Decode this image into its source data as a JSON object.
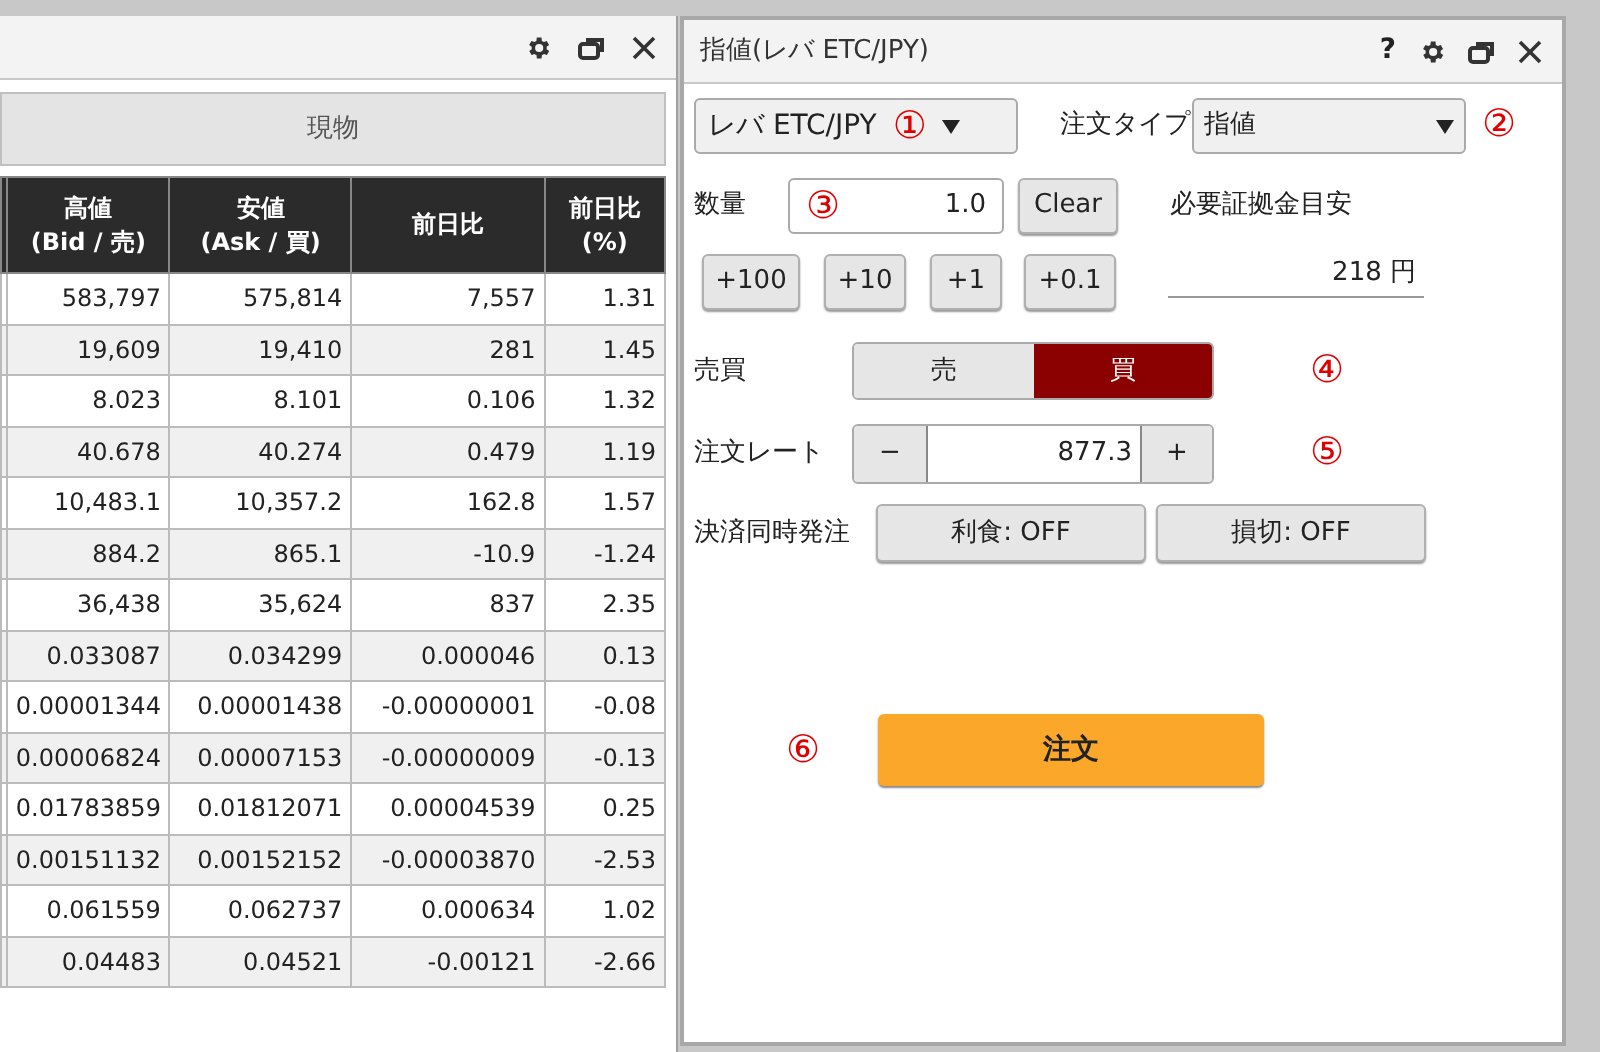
{
  "quote_panel": {
    "tab": "現物",
    "columns": [
      {
        "line1": "高値",
        "line2": "(Bid / 売)"
      },
      {
        "line1": "安値",
        "line2": "(Ask / 買)"
      },
      {
        "line1": "前日比"
      },
      {
        "line1": "前日比",
        "line2": "(%)"
      }
    ],
    "rows": [
      [
        "583,797",
        "575,814",
        "7,557",
        "1.31"
      ],
      [
        "19,609",
        "19,410",
        "281",
        "1.45"
      ],
      [
        "8.023",
        "8.101",
        "0.106",
        "1.32"
      ],
      [
        "40.678",
        "40.274",
        "0.479",
        "1.19"
      ],
      [
        "10,483.1",
        "10,357.2",
        "162.8",
        "1.57"
      ],
      [
        "884.2",
        "865.1",
        "-10.9",
        "-1.24"
      ],
      [
        "36,438",
        "35,624",
        "837",
        "2.35"
      ],
      [
        "0.033087",
        "0.034299",
        "0.000046",
        "0.13"
      ],
      [
        "0.00001344",
        "0.00001438",
        "-0.00000001",
        "-0.08"
      ],
      [
        "0.00006824",
        "0.00007153",
        "-0.00000009",
        "-0.13"
      ],
      [
        "0.01783859",
        "0.01812071",
        "0.00004539",
        "0.25"
      ],
      [
        "0.00151132",
        "0.00152152",
        "-0.00003870",
        "-2.53"
      ],
      [
        "0.061559",
        "0.062737",
        "0.000634",
        "1.02"
      ],
      [
        "0.04483",
        "0.04521",
        "-0.00121",
        "-2.66"
      ]
    ]
  },
  "order_panel": {
    "title": "指値(レバ ETC/JPY)",
    "help": "?",
    "symbol": {
      "value": "レバ ETC/JPY",
      "marker": "①"
    },
    "order_type": {
      "label": "注文タイプ",
      "value": "指値",
      "marker": "②"
    },
    "quantity": {
      "label": "数量",
      "value": "1.0",
      "marker": "③",
      "clear": "Clear"
    },
    "increments": [
      "+100",
      "+10",
      "+1",
      "+0.1"
    ],
    "margin": {
      "label": "必要証拠金目安",
      "value": "218 円"
    },
    "side": {
      "label": "売買",
      "options": [
        {
          "label": "売",
          "selected": false
        },
        {
          "label": "買",
          "selected": true
        }
      ],
      "marker": "④"
    },
    "rate": {
      "label": "注文レート",
      "minus": "−",
      "value": "877.3",
      "plus": "+",
      "marker": "⑤"
    },
    "settlement": {
      "label": "決済同時発注",
      "buttons": [
        "利食: OFF",
        "損切: OFF"
      ]
    },
    "order_button": {
      "label": "注文",
      "marker": "⑥"
    }
  }
}
